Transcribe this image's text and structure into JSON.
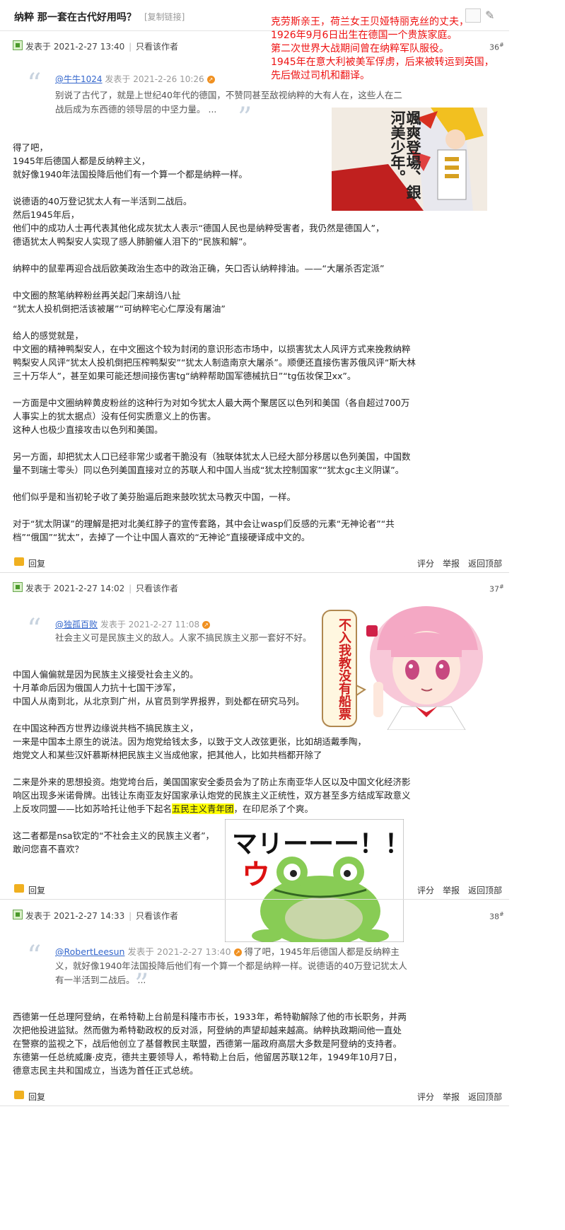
{
  "header": {
    "title": "纳粹 那一套在古代好用吗？",
    "copy_link": "[复制链接]"
  },
  "note": {
    "lines": [
      "克劳斯亲王，荷兰女王贝娅特丽克丝的丈夫，",
      "1926年9月6日出生在德国一个贵族家庭。",
      "第二次世界大战期间曾在纳粹军队服役。",
      "1945年在意大利被美军俘虏，后来被转运到英国，",
      "先后做过司机和翻译。"
    ]
  },
  "common": {
    "author_only": "只看该作者",
    "reply": "回复",
    "rate": "评分",
    "report": "举报",
    "back_top": "返回顶部",
    "floor_mark": "#"
  },
  "posts": [
    {
      "posted": "发表于  2021-2-27 13:40",
      "floor": "36",
      "quote_user": "@牛牛1024",
      "quote_time": "发表于 2021-2-26 10:26",
      "quote_text": "别说了古代了，就是上世纪40年代的德国，不赞同甚至敌视纳粹的大有人在，这些人在二战后成为东西德的领导层的中坚力量。 ...",
      "image_text": "颯爽登場、銀河美少年。",
      "paragraphs": [
        [
          "得了吧，",
          "1945年后德国人都是反纳粹主义，",
          "就好像1940年法国投降后他们有一个算一个都是纳粹一样。"
        ],
        [
          "说德语的40万登记犹太人有一半活到二战后。",
          "然后1945年后，",
          "他们中的成功人士再代表其他化成灰犹太人表示“德国人民也是纳粹受害者，我仍然是德国人”，",
          "德语犹太人鸭梨安人实现了感人肺腑催人泪下的“民族和解”。"
        ],
        [
          "纳粹中的鼠辈再迎合战后欧美政治生态中的政治正确，矢口否认纳粹排油。——“大屠杀否定派”"
        ],
        [
          "中文圈的熬笔纳粹粉丝再关起门来胡诌八扯",
          "“犹太人投机倒把活该被屠”“可纳粹宅心仁厚没有屠油”"
        ],
        [
          "给人的感觉就是，",
          "中文圈的精神鸭梨安人，在中文圈这个较为封闭的意识形态市场中，以损害犹太人风评方式来挽救纳粹鸭梨安人风评“犹太人投机倒把压榨鸭梨安”“犹太人制造南京大屠杀”。顺便还直接伤害苏俄风评“斯大林三十万华人”，甚至如果可能还想间接伤害tg“纳粹帮助国军德械抗日”“tg伍妆保卫xx”。"
        ],
        [
          "一方面是中文圈纳粹黄皮粉丝的这种行为对如今犹太人最大两个聚居区以色列和美国（各自超过700万人事实上的犹太据点）没有任何实质意义上的伤害。",
          "这种人也极少直接攻击以色列和美国。"
        ],
        [
          "另一方面，却把犹太人口已经非常少或者干脆没有（独联体犹太人已经大部分移居以色列美国，中国数量不到瑞士零头）同以色列美国直接对立的苏联人和中国人当成“犹太控制国家”“犹太gc主义阴谋”。"
        ],
        [
          "他们似乎是和当初轮子收了美芬胎逼后跑来鼓吹犹太马教灭中国，一样。"
        ],
        [
          "对于“犹太阴谋”的理解是把对北美红脖子的宣传套路，其中会让wasp们反感的元素“无神论者”“共档”“俄国”“犹太”，去掉了一个让中国人喜欢的“无神论”直接硬译成中文的。"
        ]
      ]
    },
    {
      "posted": "发表于  2021-2-27 14:02",
      "floor": "37",
      "quote_user": "@独孤百败",
      "quote_time": "发表于 2021-2-27 11:08",
      "quote_text": "社会主义可是民族主义的敌人。人家不搞民族主义那一套好不好。",
      "image_text": "不入我教没有船票",
      "frog_text": "マリーーー！！",
      "frog_text2": "ウ",
      "paragraphs": [
        [
          "中国人偏偏就是因为民族主义接受社会主义的。",
          "十月革命后因为俄国人力抗十七国干涉军，",
          "中国人从南到北，从北京到广州，从官员到学界报界，到处都在研究马列。"
        ],
        [
          "在中国这种西方世界边缘说共档不搞民族主义，",
          "一来是中国本土原生的说法。因为炮党给钱太多，以致于文人改弦更张，比如胡适戴季陶，",
          "炮党文人和某些汉奸慕斯林把民族主义当成他家，把其他人，比如共档都开除了"
        ],
        [
          "二来是外来的思想投资。炮党垮台后，美国国家安全委员会为了防止东南亚华人区以及中国文化经济影响区出现多米诺骨牌。出钱让东南亚友好国家承认炮党的民族主义正统性，双方甚至多方结成军政意义上反攻同盟——比如苏哈托让他手下起名五民主义青年团，在印尼杀了个爽。"
        ],
        [
          "这二者都是nsa钦定的“不社会主义的民族主义者”，",
          "敢问您喜不喜欢？"
        ]
      ],
      "hl_before": "出钱让东南亚友好国家承认炮党的民族主义正统性，双方甚至多方结成军政意义上反攻同盟——比如苏哈托让他手下起名五民主义青年团，在印尼杀了个爽。"
    },
    {
      "posted": "发表于  2021-2-27 14:33",
      "floor": "38",
      "quote_user": "@RobertLeesun",
      "quote_time": "发表于 2021-2-27 13:40",
      "quote_text": "得了吧，1945年后德国人都是反纳粹主义，就好像1940年法国投降后他们有一个算一个都是纳粹一样。说德语的40万登记犹太人有一半活到二战后。 ...",
      "paragraphs": [
        [
          "西德第一任总理阿登纳，在希特勒上台前是科隆市市长，1933年，希特勒解除了他的市长职务，并两次把他投进监狱。然而傲为希特勒政权的反对派，阿登纳的声望却越来越高。纳粹执政期间他一直处在警察的监视之下，战后他创立了基督教民主联盟，西德第一届政府高层大多数是阿登纳的支持者。东德第一任总统威廉·皮克，德共主要领导人，希特勒上台后，他留居苏联12年，1949年10月7日，德意志民主共和国成立，当选为首任正式总统。"
        ]
      ]
    }
  ]
}
